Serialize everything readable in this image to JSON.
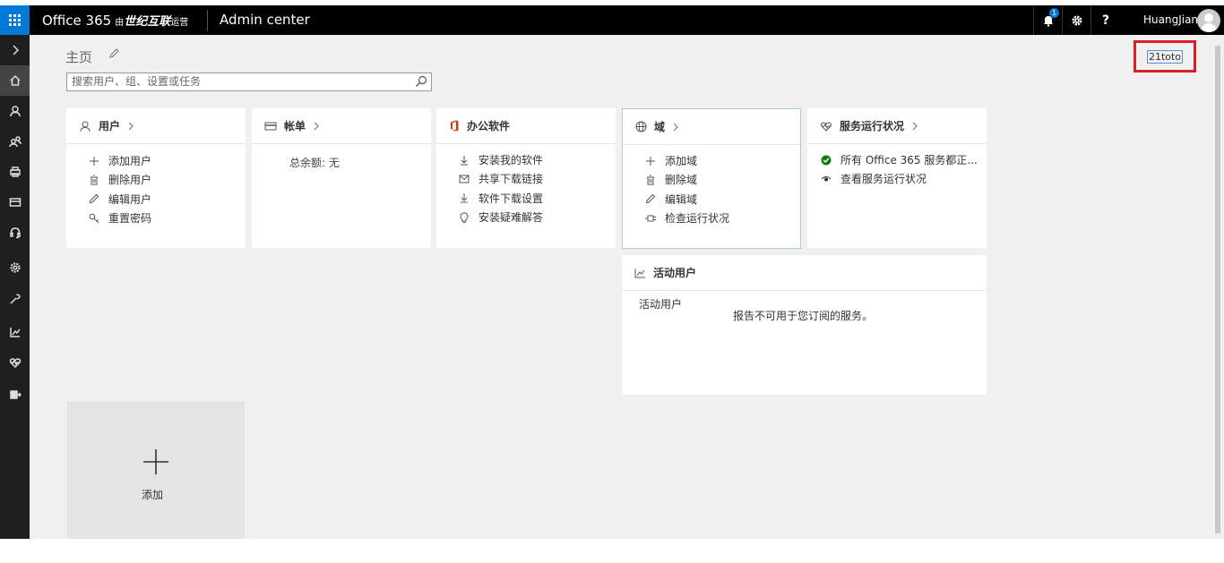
{
  "topbar": {
    "brand": "Office 365",
    "operator_prefix": "由",
    "operator_name": "世纪互联",
    "operator_suffix": "运营",
    "app_name": "Admin center",
    "notification_count": "1",
    "help_label": "?",
    "user_name": "HuangJian"
  },
  "sidebar": {
    "items": [
      "expand-icon",
      "home-icon",
      "users-icon",
      "groups-icon",
      "resources-icon",
      "billing-icon",
      "support-icon",
      "settings-icon",
      "setup-icon",
      "reports-icon",
      "health-icon",
      "admin-centers-icon"
    ]
  },
  "main": {
    "title": "主页",
    "search_placeholder": "搜索用户、组、设置或任务",
    "tenant_label": "21toto"
  },
  "cards": {
    "users": {
      "title": "用户",
      "actions": [
        "添加用户",
        "删除用户",
        "编辑用户",
        "重置密码"
      ]
    },
    "billing": {
      "title": "帐单",
      "balance": "总余额: 无"
    },
    "office": {
      "title": "办公软件",
      "actions": [
        "安装我的软件",
        "共享下载链接",
        "软件下载设置",
        "安装疑难解答"
      ]
    },
    "domains": {
      "title": "域",
      "actions": [
        "添加域",
        "删除域",
        "编辑域",
        "检查运行状况"
      ]
    },
    "health": {
      "title": "服务运行状况",
      "status": "所有 Office 365 服务都正...",
      "view": "查看服务运行状况"
    },
    "active_users": {
      "title": "活动用户",
      "label": "活动用户",
      "message": "报告不可用于您订阅的服务。"
    }
  },
  "add_tile": {
    "label": "添加"
  },
  "colors": {
    "accent": "#0078d7",
    "highlight": "#d61f26",
    "status_ok": "#107c10"
  }
}
